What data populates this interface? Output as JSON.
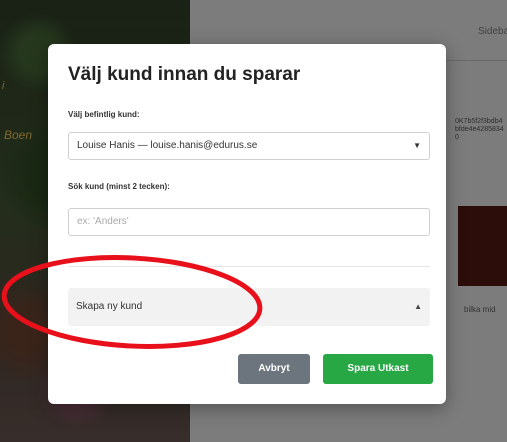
{
  "background": {
    "card_text_1": "Boen",
    "card_text_2": "i",
    "tab_label": "Sidebar",
    "code_text": "0K7b5f2f3bdb4bfde4e42858340",
    "caption": "bilka mid"
  },
  "modal": {
    "title": "Välj kund innan du sparar",
    "existing_label": "Välj befintlig kund:",
    "existing_value": "Louise Hanis — louise.hanis@edurus.se",
    "search_label": "Sök kund (minst 2 tecken):",
    "search_placeholder": "ex: 'Anders'",
    "create_label": "Skapa ny kund",
    "cancel_label": "Avbryt",
    "save_label": "Spara Utkast"
  },
  "colors": {
    "save_button": "#28a745",
    "cancel_button": "#6c757d",
    "annotation": "#e8101a"
  }
}
